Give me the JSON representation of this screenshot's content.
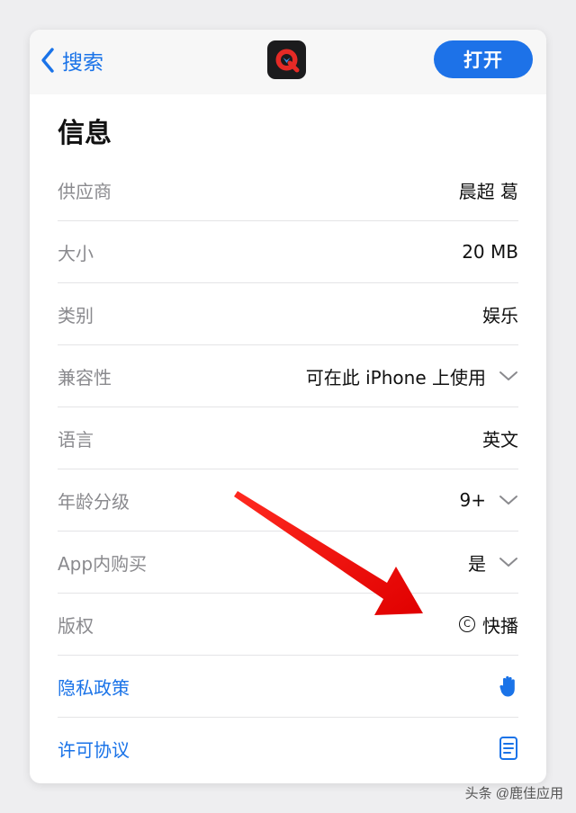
{
  "navbar": {
    "back_label": "搜索",
    "open_label": "打开"
  },
  "section": {
    "title": "信息"
  },
  "rows": [
    {
      "label": "供应商",
      "value": "晨超 葛"
    },
    {
      "label": "大小",
      "value": "20 MB"
    },
    {
      "label": "类别",
      "value": "娱乐"
    },
    {
      "label": "兼容性",
      "value": "可在此 iPhone 上使用"
    },
    {
      "label": "语言",
      "value": "英文"
    },
    {
      "label": "年龄分级",
      "value": "9+"
    },
    {
      "label": "App内购买",
      "value": "是"
    },
    {
      "label": "版权",
      "value": "快播"
    }
  ],
  "links": {
    "privacy": "隐私政策",
    "license": "许可协议"
  },
  "watermark": "头条 @鹿佳应用",
  "colors": {
    "accent": "#1a73e8",
    "open_button": "#1d72e8",
    "arrow": "#f20c0c"
  }
}
